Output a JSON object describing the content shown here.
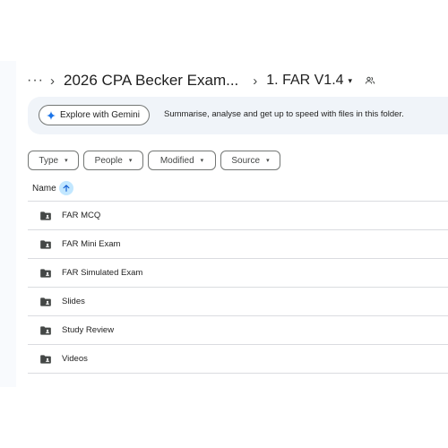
{
  "breadcrumb": {
    "more_label": "···",
    "separator": "›",
    "parent": "2026 CPA Becker Exam...",
    "current": "1. FAR V1.4",
    "current_caret": "▾",
    "shared_icon": "shared-folder-people-icon"
  },
  "gemini": {
    "button_label": "Explore with Gemini",
    "button_icon": "gemini-sparkle-icon",
    "description": "Summarise, analyse and get up to speed with files in this folder.",
    "accent": "#1a73e8"
  },
  "filters": [
    {
      "label": "Type",
      "caret": "▾"
    },
    {
      "label": "People",
      "caret": "▾"
    },
    {
      "label": "Modified",
      "caret": "▾"
    },
    {
      "label": "Source",
      "caret": "▾"
    }
  ],
  "list": {
    "column_name": "Name",
    "sort_icon": "arrow-up-icon",
    "sort_color": "#c2e7ff",
    "folder_icon": "shared-folder-icon",
    "items": [
      {
        "name": "FAR MCQ"
      },
      {
        "name": "FAR Mini Exam"
      },
      {
        "name": "FAR Simulated Exam"
      },
      {
        "name": "Slides"
      },
      {
        "name": "Study Review"
      },
      {
        "name": "Videos"
      }
    ]
  }
}
